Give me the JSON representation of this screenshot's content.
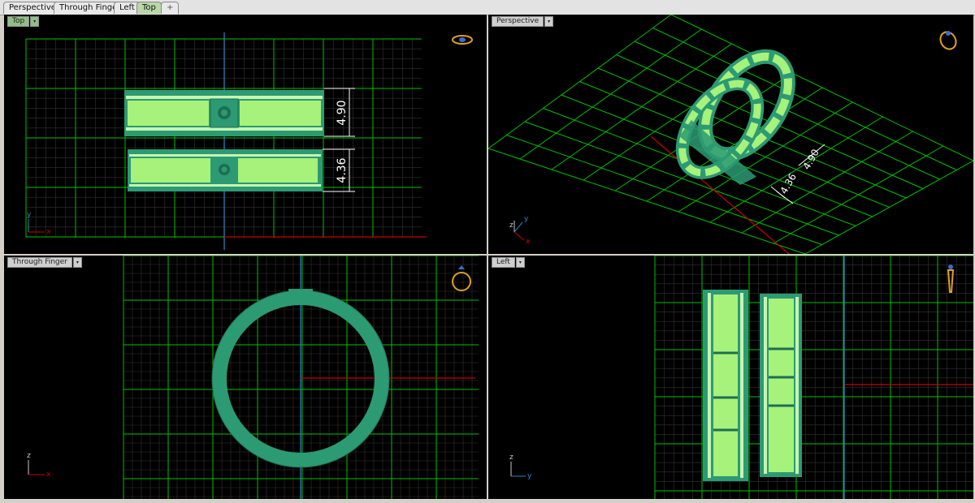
{
  "tabs": [
    {
      "label": "Perspective",
      "active": false
    },
    {
      "label": "Through Finger",
      "active": false
    },
    {
      "label": "Left",
      "active": false
    },
    {
      "label": "Top",
      "active": true
    }
  ],
  "add_tab_symbol": "+",
  "viewports": {
    "top": {
      "label": "Top",
      "dim_a": "4.90",
      "dim_b": "4.36",
      "axis_x": "x",
      "axis_y": "y"
    },
    "perspective": {
      "label": "Perspective",
      "dim_a": "4.90",
      "dim_b": "4.36",
      "axis_x": "x",
      "axis_y": "y",
      "axis_z": "z"
    },
    "through_finger": {
      "label": "Through Finger",
      "axis_x": "x",
      "axis_y": "z"
    },
    "left": {
      "label": "Left",
      "axis_x": "y",
      "axis_y": "z"
    }
  },
  "dropdown_symbol": "▾",
  "colors": {
    "grid_major": "#00c800",
    "grid_minor": "#3a3a3a",
    "ring": "#2c9a73",
    "ring_light": "#a6f27a",
    "axis_x": "#c80000",
    "axis_y": "#2a8ac8",
    "gumball": "#e0a020"
  }
}
